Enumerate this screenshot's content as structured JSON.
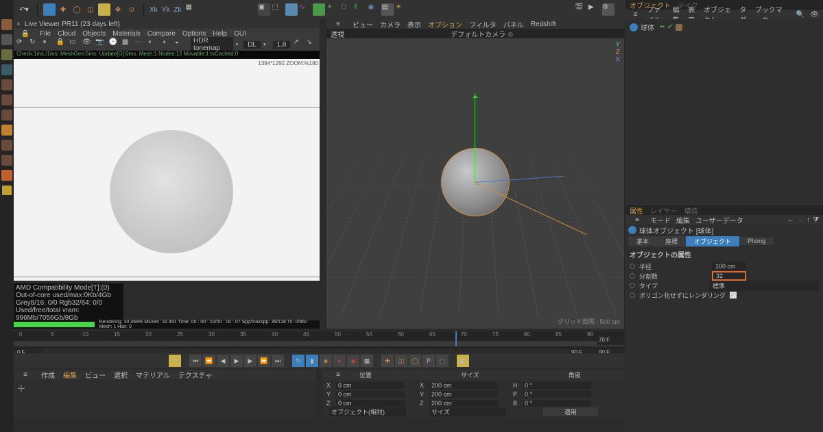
{
  "top_toolbar": {
    "axes": [
      "Xk",
      "Yk",
      "Zk"
    ]
  },
  "live_viewer": {
    "title": "Live Viewer PR11 (23 days left)",
    "menu": [
      "File",
      "Cloud",
      "Objects",
      "Materials",
      "Compare",
      "Options",
      "Help",
      "GUI"
    ],
    "tonemap": "HDR tonemap",
    "picker": "DL",
    "exposure": "1.8",
    "status": "Check:1ms./1ms. MeshGen:5ms. Update[G]:0ms. Mesh:1 Nodes:12 Movable:1 txCached:0",
    "zoom": "1394*1292 ZOOM:%180",
    "stats": [
      "AMD Compatibility Mode[T]:(0)",
      "Out-of-core used/max:0Kb/4Gb",
      "Grey8/16: 0/0        Rgb32/64: 0/0",
      "Used/free/total vram: 996Mb/7056Gb/8Gb"
    ],
    "render": "Rendering: 30.469%   Ms/sec: 32.491  Time: 00 : 00 : 02/00 : 00 : 07   Spp/maxspp: 39/128   Tri: 0/960   Mesh: 1   Hair: 0"
  },
  "viewport": {
    "menu": [
      "ビュー",
      "カメラ",
      "表示",
      "オプション",
      "フィルタ",
      "パネル",
      "Redshift"
    ],
    "persp": "透視",
    "camera": "デフォルトカメラ",
    "hud": [
      "Y",
      "Z",
      "X"
    ],
    "grid": "グリッド間隔 : 500 cm"
  },
  "objects": {
    "tabs": [
      "オブジェクト",
      "テイク"
    ],
    "menu": [
      "ファイル",
      "編集",
      "表示",
      "オブジェクト",
      "タグ",
      "ブックマーク"
    ],
    "item": "球体"
  },
  "attributes": {
    "tabs": [
      "属性",
      "レイヤー",
      "構造"
    ],
    "menu": [
      "モード",
      "編集",
      "ユーザーデータ"
    ],
    "obj_name": "球体オブジェクト [球体]",
    "subtabs": [
      "基本",
      "座標",
      "オブジェクト",
      "Phong"
    ],
    "subtab_selected": 2,
    "header": "オブジェクトの属性",
    "rows": [
      {
        "label": "半径",
        "value": "100 cm",
        "hl": false
      },
      {
        "label": "分割数",
        "value": "32",
        "hl": true
      },
      {
        "label": "タイプ",
        "value": "標準",
        "hl": false
      },
      {
        "label": "ポリゴン化せずにレンダリング",
        "checkbox": true
      }
    ]
  },
  "timeline": {
    "ticks": [
      0,
      5,
      10,
      15,
      20,
      25,
      30,
      35,
      40,
      45,
      50,
      55,
      60,
      65,
      70,
      75,
      80,
      85,
      90
    ],
    "current": 70,
    "start": "0 F",
    "end": "90 F",
    "end2": "70 F",
    "end3": "90 F"
  },
  "coords": {
    "headers": [
      "位置",
      "サイズ",
      "角度"
    ],
    "rows": [
      {
        "a": "X",
        "p": "0 cm",
        "s": "200 cm",
        "al": "H",
        "av": "0 °"
      },
      {
        "a": "Y",
        "p": "0 cm",
        "s": "200 cm",
        "al": "P",
        "av": "0 °"
      },
      {
        "a": "Z",
        "p": "0 cm",
        "s": "200 cm",
        "al": "B",
        "av": "0 °"
      }
    ],
    "drop1": "オブジェクト(相対)",
    "drop2": "サイズ",
    "apply": "適用"
  },
  "materials": {
    "menu": [
      "作成",
      "編集",
      "ビュー",
      "選択",
      "マテリアル",
      "テクスチャ"
    ]
  }
}
